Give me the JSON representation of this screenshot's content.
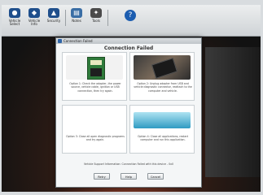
{
  "toolbar": {
    "buttons": [
      {
        "label": "Vehicle Select",
        "icon": "vehicle-icon"
      },
      {
        "label": "Vehicle Info",
        "icon": "info-icon"
      },
      {
        "label": "Security",
        "icon": "shield-icon"
      },
      {
        "label": "Notes",
        "icon": "notes-icon"
      },
      {
        "label": "Tools",
        "icon": "tools-icon"
      }
    ],
    "help_icon": "help-icon"
  },
  "dialog": {
    "window_title": "Connection Failed",
    "heading": "Connection Failed",
    "options": [
      {
        "text": "Option 1: Check the adapter, the power source, vehicle cable, ignition or USB connection, then try again.",
        "image": "adapter-board-image"
      },
      {
        "text": "Option 2: Unplug adapter from USB and vehicle diagnostic connector, reattach to the computer and vehicle.",
        "image": "adapter-device-image"
      },
      {
        "text": "Option 3: Close all open diagnostic programs and try again.",
        "image": ""
      },
      {
        "text": "Option 4: Close all applications, restart computer and run this application.",
        "image": "desktop-image"
      }
    ],
    "status_text": "Vehicle Support Information: Connection Failed with this device - 0x0",
    "buttons": [
      "Retry",
      "Help",
      "Cancel"
    ]
  },
  "colors": {
    "accent": "#1f4f8c",
    "dialog_bg": "#f4f6f7"
  }
}
